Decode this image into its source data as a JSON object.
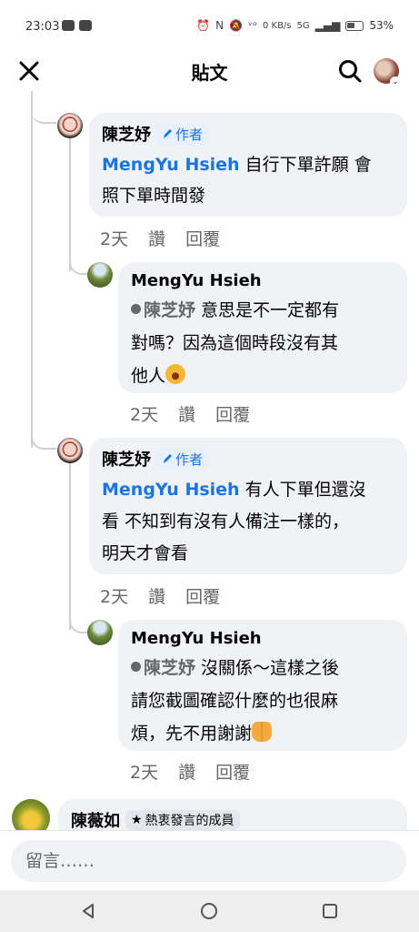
{
  "status_bar": {
    "time": "23:03",
    "network_speed": "0 KB/s",
    "network_type": "5G",
    "battery": "53%"
  },
  "header": {
    "title": "貼文",
    "close_icon": "close-icon",
    "search_icon": "search-icon"
  },
  "comments": [
    {
      "author": "陳芝妤",
      "badge": "作者",
      "mention": "MengYu Hsieh",
      "text_lines": [
        " 自行下單許願 會",
        "照下單時間發"
      ],
      "time": "2天",
      "like": "讚",
      "reply": "回覆"
    },
    {
      "author": "MengYu Hsieh",
      "mention": "陳芝妤",
      "text_lines": [
        " 意思是不一定都有",
        "對嗎？因為這個時段沒有其",
        "他人"
      ],
      "emoji": "rolling-laughing",
      "time": "2天",
      "like": "讚",
      "reply": "回覆"
    },
    {
      "author": "陳芝妤",
      "badge": "作者",
      "mention": "MengYu Hsieh",
      "text_lines": [
        " 有人下單但還沒",
        "看 不知到有沒有人備注一樣的，",
        "明天才會看"
      ],
      "time": "2天",
      "like": "讚",
      "reply": "回覆"
    },
    {
      "author": "MengYu Hsieh",
      "mention": "陳芝妤",
      "text_lines": [
        " 沒關係～這樣之後",
        "請您截圖確認什麼的也很麻",
        "煩，先不用謝謝"
      ],
      "emoji": "folded-hands",
      "time": "2天",
      "like": "讚",
      "reply": "回覆"
    },
    {
      "author": "陳薇如",
      "badge": "熱衷發言的成員"
    }
  ],
  "composer": {
    "placeholder": "留言……"
  },
  "colors": {
    "link_blue": "#1b74e4",
    "bubble_bg": "#f0f2f5",
    "meta_gray": "#65676b"
  }
}
